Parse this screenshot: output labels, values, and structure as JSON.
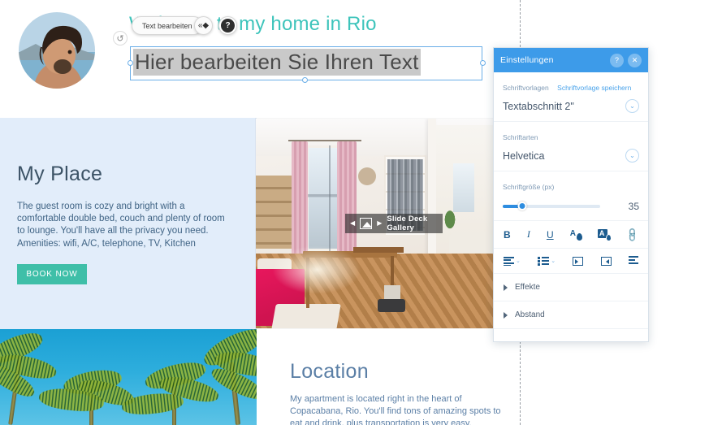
{
  "site": {
    "heading": "Welcome to my home in Rio",
    "my_place": {
      "title": "My Place",
      "body": "The guest room is cozy and bright with a comfortable double bed, couch and plenty of room to lounge. You'll have all the privacy you need. Amenities: wifi, A/C, telephone, TV, Kitchen",
      "button": "BOOK NOW"
    },
    "location": {
      "title": "Location",
      "body": "My apartment is located right in the heart of Copacabana, Rio. You'll find tons of amazing spots to eat and drink, plus transportation is very easy."
    },
    "gallery_overlay": {
      "label": "Slide Deck Gallery",
      "left_arrow": "◀",
      "right_arrow": "▶"
    }
  },
  "editor": {
    "selected_text": "Hier bearbeiten Sie Ihren Text",
    "toolbar": {
      "edit_text_button": "Text bearbeiten",
      "drag_handle": "«◆",
      "help_button": "?",
      "undo_button": "↺"
    }
  },
  "panel": {
    "title": "Einstellungen",
    "help_button": "?",
    "close_button": "✕",
    "font_templates": {
      "label": "Schriftvorlagen",
      "save_link": "Schriftvorlage speichern",
      "value": "Textabschnitt 2\"",
      "chevron": "⌄"
    },
    "font_family": {
      "label": "Schriftarten",
      "value": "Helvetica",
      "chevron": "⌄"
    },
    "font_size": {
      "label": "Schriftgröße (px)",
      "value": "35",
      "slider_percent": 20
    },
    "format_tools": {
      "bold": "B",
      "italic": "I",
      "underline": "U",
      "text_color": "A",
      "highlight_color": "A",
      "link": "🔗"
    },
    "paragraph_tools": {
      "align": "align",
      "align_chevron": "⌄",
      "list": "list",
      "list_chevron": "⌄",
      "indent_decrease": "indent-decrease",
      "indent_increase": "indent-increase",
      "text_direction": "text-direction"
    },
    "sections": [
      {
        "label": "Effekte"
      },
      {
        "label": "Abstand"
      }
    ]
  },
  "colors": {
    "panel_header": "#3d9be9",
    "accent_teal": "#3ec4bb",
    "button_green": "#3fbfa8",
    "selection_blue": "#6aaee8",
    "band_bg": "#e2edfa"
  }
}
